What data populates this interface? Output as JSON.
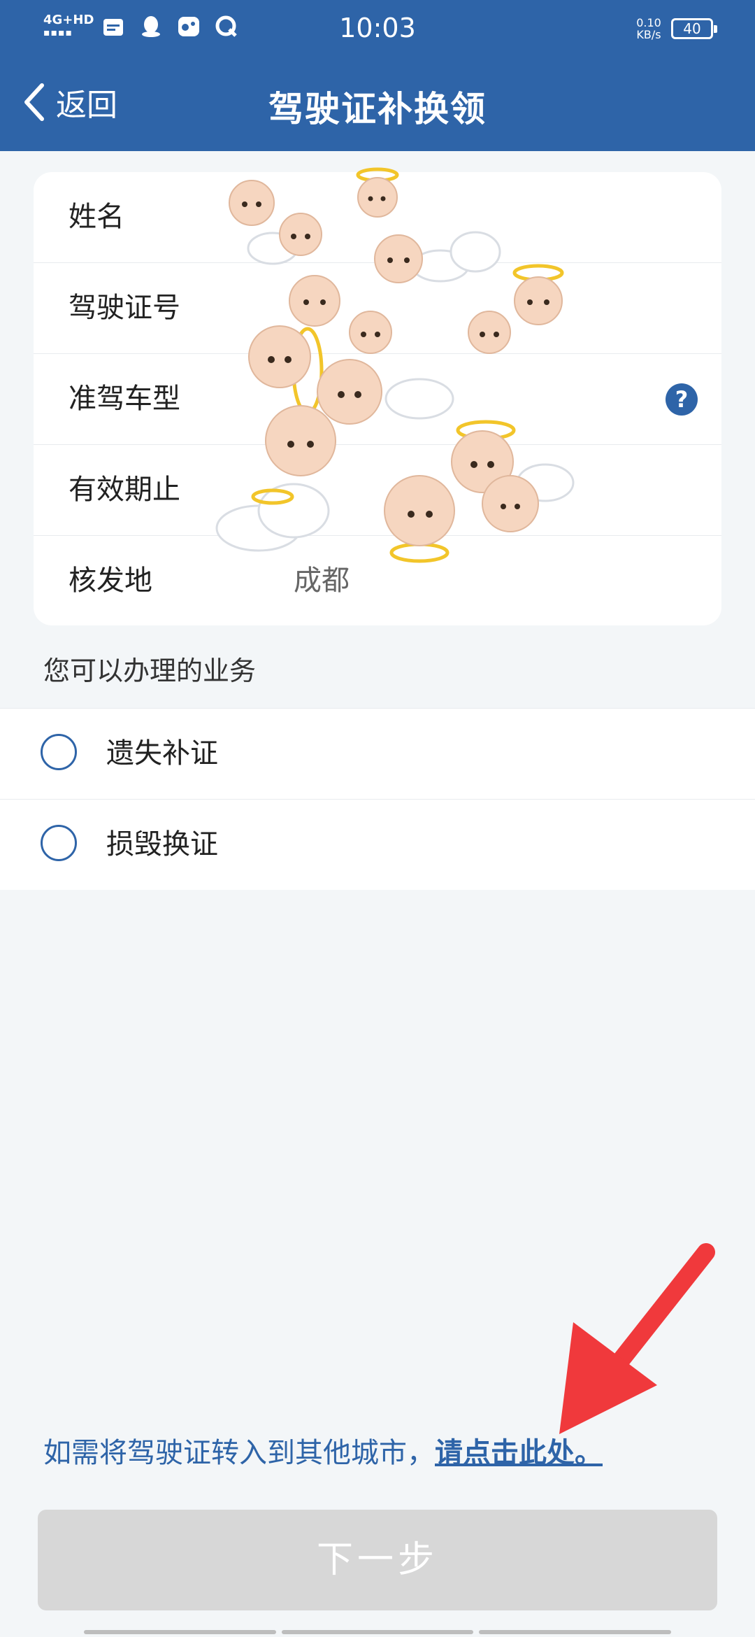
{
  "status_bar": {
    "network": "4G+HD",
    "time": "10:03",
    "net_speed_value": "0.10",
    "net_speed_unit": "KB/s",
    "battery": "40"
  },
  "header": {
    "back_label": "返回",
    "title": "驾驶证补换领"
  },
  "info": {
    "rows": [
      {
        "label": "姓名",
        "value": ""
      },
      {
        "label": "驾驶证号",
        "value": ""
      },
      {
        "label": "准驾车型",
        "value": ""
      },
      {
        "label": "有效期止",
        "value": ""
      },
      {
        "label": "核发地",
        "value": "成都"
      }
    ],
    "help_icon": "?"
  },
  "services": {
    "title": "您可以办理的业务",
    "options": [
      {
        "label": "遗失补证",
        "selected": false
      },
      {
        "label": "损毁换证",
        "selected": false
      }
    ]
  },
  "notice": {
    "text": "如需将驾驶证转入到其他城市，",
    "link": "请点击此处。"
  },
  "next_button": "下一步",
  "colors": {
    "primary": "#2e64a8",
    "background": "#f3f6f8",
    "disabled_button": "#d7d7d7",
    "annotation_arrow": "#f0393c"
  }
}
